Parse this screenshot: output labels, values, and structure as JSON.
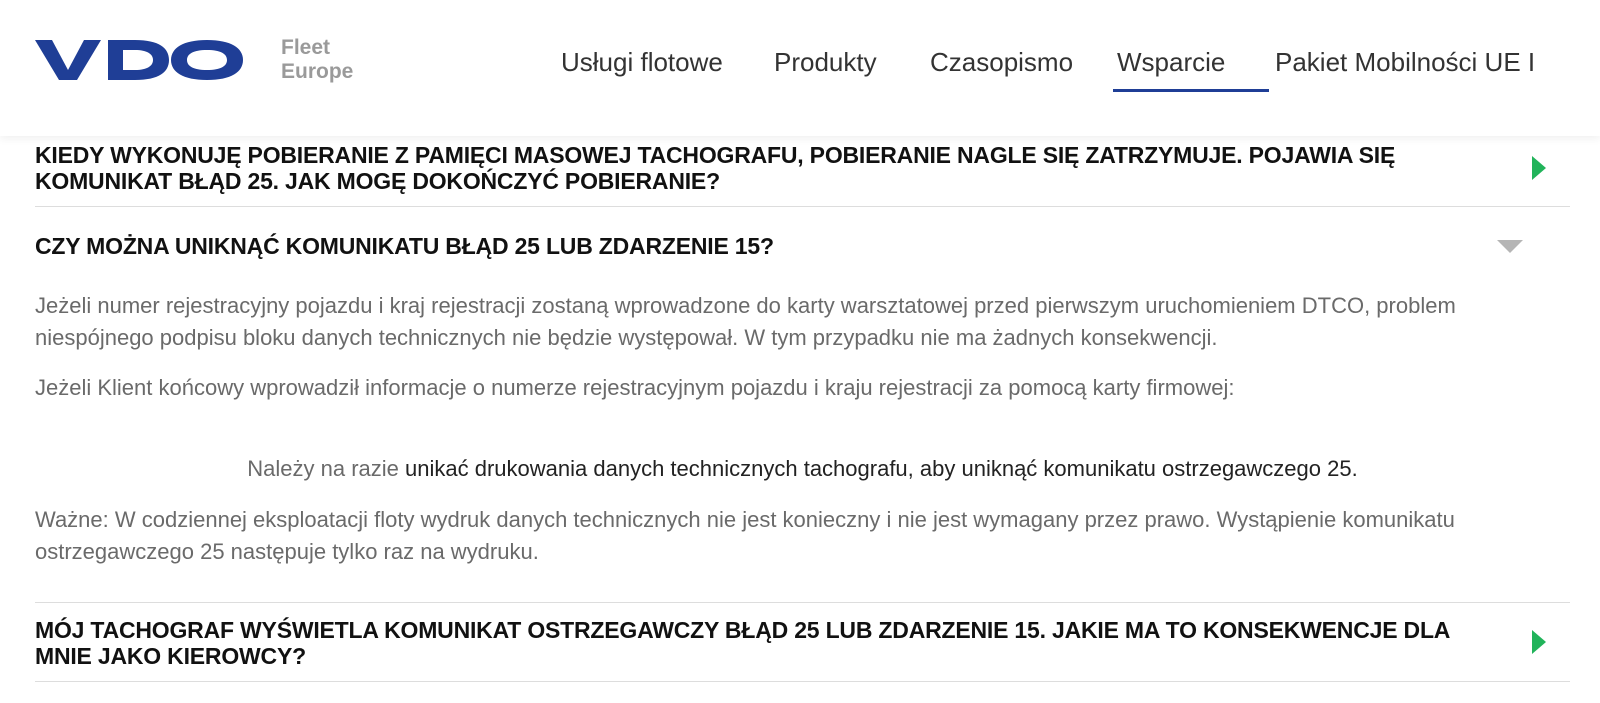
{
  "brand": {
    "logo_text": "VDO",
    "sub_line1": "Fleet",
    "sub_line2": "Europe",
    "logo_color": "#1f3e96"
  },
  "nav": {
    "items": [
      {
        "label": "Usługi flotowe"
      },
      {
        "label": "Produkty"
      },
      {
        "label": "Czasopismo"
      },
      {
        "label": "Wsparcie"
      },
      {
        "label": "Pakiet Mobilności UE I"
      }
    ],
    "active": "Wsparcie",
    "accent": "#1f3e96"
  },
  "faq": [
    {
      "question": "KIEDY WYKONUJĘ POBIERANIE Z PAMIĘCI MASOWEJ TACHOGRAFU, POBIERANIE NAGLE SIĘ ZATRZYMUJE. POJAWIA SIĘ KOMUNIKAT BŁĄD 25. JAK MOGĘ DOKOŃCZYĆ POBIERANIE?",
      "state": "collapsed"
    },
    {
      "question": "CZY MOŻNA UNIKNĄĆ KOMUNIKATU BŁĄD 25 LUB ZDARZENIE 15?",
      "state": "expanded",
      "answer": {
        "p1": "Jeżeli numer rejestracyjny pojazdu i kraj rejestracji zostaną wprowadzone do karty warsztatowej przed pierwszym uruchomieniem DTCO, problem niespójnego podpisu bloku danych technicznych nie będzie występował. W tym przypadku nie ma żadnych konsekwencji.",
        "p2": "Jeżeli Klient końcowy wprowadził informacje o numerze rejestracyjnym pojazdu i kraju rejestracji za pomocą karty firmowej:",
        "callout_prefix": "Należy na razie ",
        "callout_emphasis": "unikać drukowania danych technicznych tachografu, aby uniknąć komunikatu ostrzegawczego 25.",
        "p3": "Ważne: W codziennej eksploatacji floty wydruk danych technicznych nie jest konieczny i nie jest wymagany przez prawo. Wystąpienie komunikatu ostrzegawczego 25 następuje tylko raz na wydruku."
      }
    },
    {
      "question": "MÓJ TACHOGRAF WYŚWIETLA KOMUNIKAT OSTRZEGAWCZY BŁĄD 25 LUB ZDARZENIE 15. JAKIE MA TO KONSEKWENCJE DLA MNIE JAKO KIEROWCY?",
      "state": "collapsed"
    }
  ],
  "colors": {
    "expand_arrow": "#21b35a",
    "collapse_arrow": "#b5b5b5"
  }
}
